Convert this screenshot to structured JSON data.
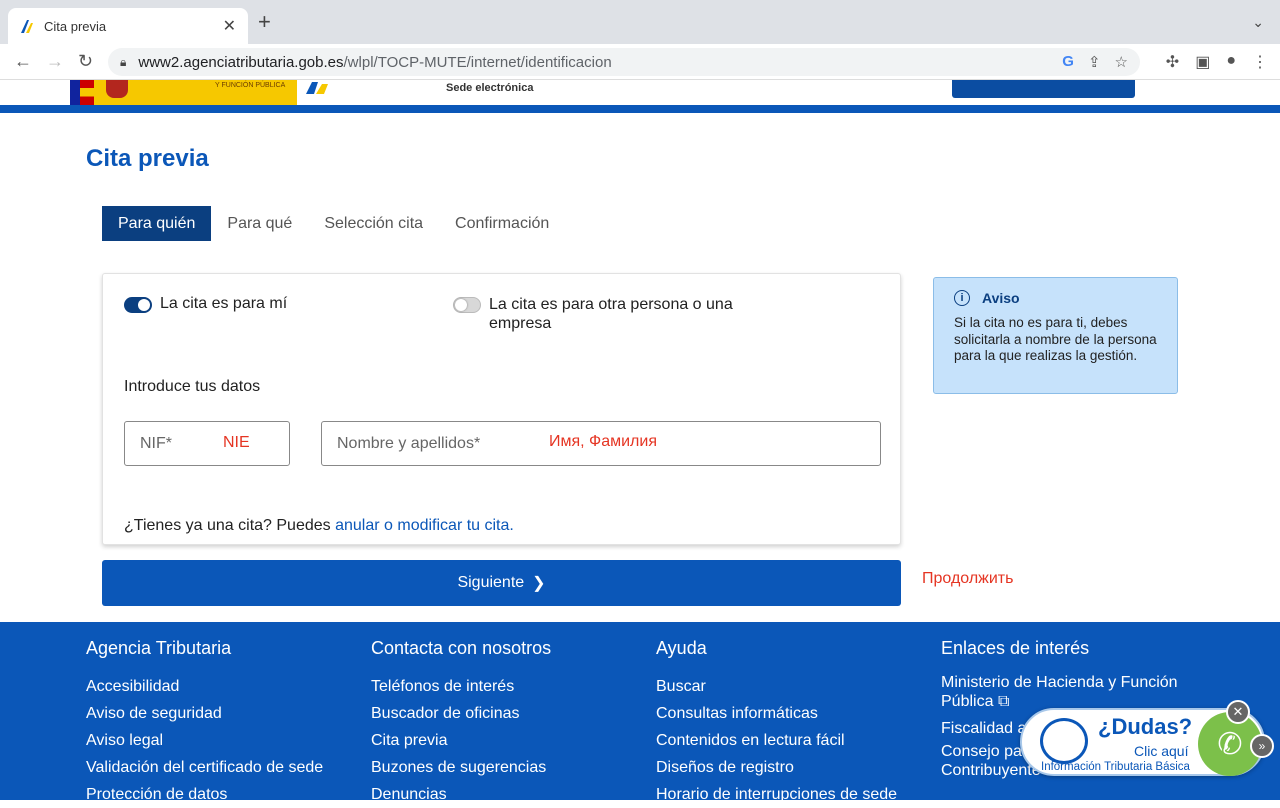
{
  "browser": {
    "tab_title": "Cita previa",
    "tab_close": "✕",
    "new_tab": "+",
    "url_host": "www2.agenciatributaria.gob.es",
    "url_path": "/wlpl/TOCP-MUTE/internet/identificacion"
  },
  "header": {
    "gov_text": "Y FUNCIÓN PÚBLICA",
    "sede": "Sede electrónica",
    "brand_color": "#0b57b8"
  },
  "page": {
    "title": "Cita previa"
  },
  "steps": [
    {
      "label": "Para quién",
      "active": true
    },
    {
      "label": "Para qué",
      "active": false
    },
    {
      "label": "Selección cita",
      "active": false
    },
    {
      "label": "Confirmación",
      "active": false
    }
  ],
  "form": {
    "toggle_me": {
      "label": "La cita es para mí",
      "on": true
    },
    "toggle_other": {
      "label": "La cita es para otra persona o una empresa",
      "on": false
    },
    "intro": "Introduce tus datos",
    "nif_placeholder": "NIF*",
    "nif_annotation": "NIE",
    "name_placeholder": "Nombre y apellidos*",
    "name_annotation": "Имя, Фамилия",
    "have_cita_prefix": "¿Tienes ya una cita? Puedes ",
    "have_cita_link": "anular o modificar tu cita."
  },
  "aviso": {
    "title": "Aviso",
    "body": "Si la cita no es para ti, debes solicitarla a nombre de la persona para la que realizas la gestión."
  },
  "next": {
    "label": "Siguiente",
    "annotation": "Продолжить",
    "annotation_color": "#e53523"
  },
  "footer": {
    "columns": [
      {
        "title": "Agencia Tributaria",
        "items": [
          "Accesibilidad",
          "Aviso de seguridad",
          "Aviso legal",
          "Validación del certificado de sede",
          "Protección de datos"
        ]
      },
      {
        "title": "Contacta con nosotros",
        "items": [
          "Teléfonos de interés",
          "Buscador de oficinas",
          "Cita previa",
          "Buzones de sugerencias",
          "Denuncias"
        ]
      },
      {
        "title": "Ayuda",
        "items": [
          "Buscar",
          "Consultas informáticas",
          "Contenidos en lectura fácil",
          "Diseños de registro",
          "Horario de interrupciones de sede"
        ]
      },
      {
        "title": "Enlaces de interés",
        "items": [
          "Ministerio de Hacienda y Función Pública",
          "Fiscalidad a",
          "Consejo par Contribuyente"
        ]
      }
    ]
  },
  "dudas": {
    "question": "¿Dudas?",
    "clic": "Clic aquí",
    "info": "Información Tributaria Básica"
  }
}
